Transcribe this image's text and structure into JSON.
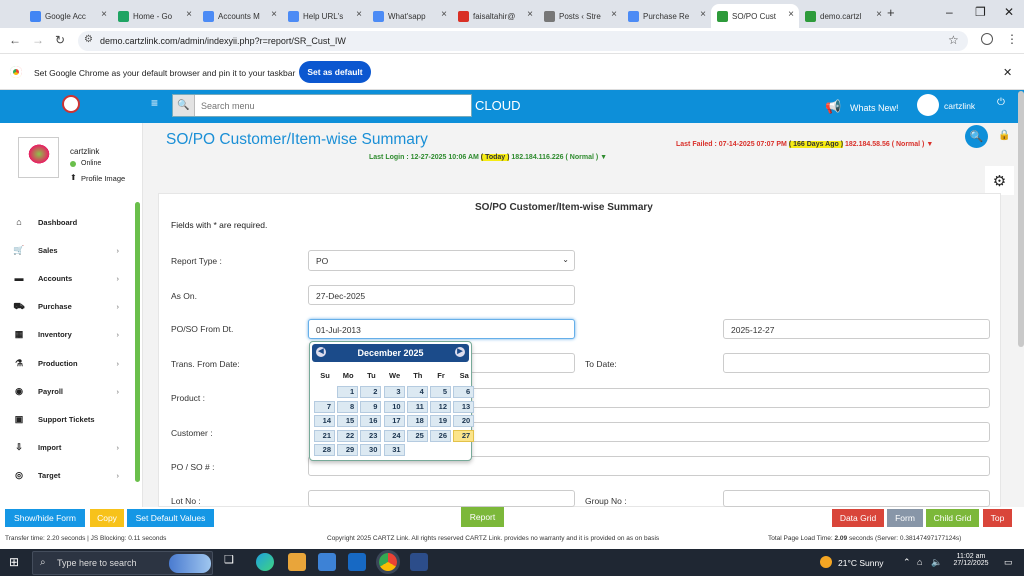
{
  "browser": {
    "tabs": [
      {
        "title": "Google Acc",
        "color": "#4285f4"
      },
      {
        "title": "Home - Go",
        "color": "#1fa463"
      },
      {
        "title": "Accounts M",
        "color": "#4c8bf5"
      },
      {
        "title": "Help URL's",
        "color": "#4c8bf5"
      },
      {
        "title": "What'sapp",
        "color": "#4c8bf5"
      },
      {
        "title": "faisaltahir@",
        "color": "#d93025"
      },
      {
        "title": "Posts ‹ Stre",
        "color": "#777"
      },
      {
        "title": "Purchase Re",
        "color": "#4c8bf5"
      },
      {
        "title": "SO/PO Cust",
        "color": "#2e9b3b"
      },
      {
        "title": "demo.cartzl",
        "color": "#2e9b3b"
      }
    ],
    "new_tab": "+",
    "url": "demo.cartzlink.com/admin/indexyii.php?r=report/SR_Cust_IW",
    "infobar_text": "Set Google Chrome as your default browser and pin it to your taskbar",
    "infobar_button": "Set as default"
  },
  "header": {
    "search_placeholder": "Search menu",
    "brand": "CLOUD",
    "whats_new": "Whats New!",
    "user": "cartzlink"
  },
  "profile": {
    "name": "cartzlink",
    "status": "Online",
    "profile_image": "Profile Image"
  },
  "sidebar": {
    "items": [
      {
        "label": "Dashboard",
        "icon": "home-icon",
        "glyph": "⌂",
        "chev": ""
      },
      {
        "label": "Sales",
        "icon": "cart-icon",
        "glyph": "🛒",
        "chev": "›"
      },
      {
        "label": "Accounts",
        "icon": "briefcase-icon",
        "glyph": "▬",
        "chev": "›"
      },
      {
        "label": "Purchase",
        "icon": "truck-icon",
        "glyph": "⛟",
        "chev": "›"
      },
      {
        "label": "Inventory",
        "icon": "grid-icon",
        "glyph": "▦",
        "chev": "›"
      },
      {
        "label": "Production",
        "icon": "flask-icon",
        "glyph": "⚗",
        "chev": "›"
      },
      {
        "label": "Payroll",
        "icon": "user-icon",
        "glyph": "◉",
        "chev": "›"
      },
      {
        "label": "Support Tickets",
        "icon": "ticket-icon",
        "glyph": "▣",
        "chev": ""
      },
      {
        "label": "Import",
        "icon": "import-icon",
        "glyph": "⇩",
        "chev": "›"
      },
      {
        "label": "Target",
        "icon": "target-icon",
        "glyph": "◎",
        "chev": "›"
      }
    ]
  },
  "page": {
    "title": "SO/PO Customer/Item-wise Summary",
    "last_login": "Last Login : 12-27-2025 10:06 AM",
    "last_login_badge": "( Today )",
    "last_login_ip": "182.184.116.226 ( Normal ) ▼",
    "last_failed": "Last Failed : 07-14-2025 07:07 PM",
    "last_failed_badge": "( 166 Days Ago )",
    "last_failed_ip": "182.184.58.56 ( Normal ) ▼"
  },
  "form": {
    "heading": "SO/PO Customer/Item-wise Summary",
    "required_note": "Fields with * are required.",
    "report_type_label": "Report Type :",
    "report_type_value": "PO",
    "as_on_label": "As On.",
    "as_on_value": "27-Dec-2025",
    "from_dt_label": "PO/SO From Dt.",
    "from_dt_value": "01-Jul-2013",
    "to_dt_value": "2025-12-27",
    "trans_from_label": "Trans. From Date:",
    "to_date_label": "To Date:",
    "product_label": "Product :",
    "customer_label": "Customer :",
    "po_so_label": "PO / SO # :",
    "lot_label": "Lot No :",
    "group_label": "Group No :"
  },
  "calendar": {
    "month": "December 2025",
    "weekdays": [
      "Su",
      "Mo",
      "Tu",
      "We",
      "Th",
      "Fr",
      "Sa"
    ],
    "first_weekday_index": 1,
    "days_in_month": 31,
    "today": 27
  },
  "buttons": {
    "show_hide": "Show/hide Form",
    "copy": "Copy",
    "set_default": "Set Default Values",
    "report": "Report",
    "data_grid": "Data Grid",
    "form": "Form",
    "child_grid": "Child Grid",
    "top": "Top"
  },
  "status": {
    "left": "Transfer time: 2.20 seconds  |  JS Blocking: 0.11 seconds",
    "center": "Copyright 2025 CARTZ Link. All rights reserved CARTZ Link. provides no warranty and it is provided on as on basis",
    "right_prefix": "Total Page Load Time:",
    "right_value": "2.09",
    "right_suffix": "seconds (Server: 0.38147497177124s)"
  },
  "taskbar": {
    "search_placeholder": "Type here to search",
    "weather": "21°C  Sunny",
    "time": "11:02 am",
    "date": "27/12/2025"
  },
  "colors": {
    "header": "#0d8fd9",
    "title": "#1a8fd6",
    "btn_blue": "#1597e5",
    "btn_yellow": "#f7c21a",
    "btn_green": "#7cb83a",
    "btn_red": "#d9453a",
    "btn_grey": "#8896a8"
  }
}
